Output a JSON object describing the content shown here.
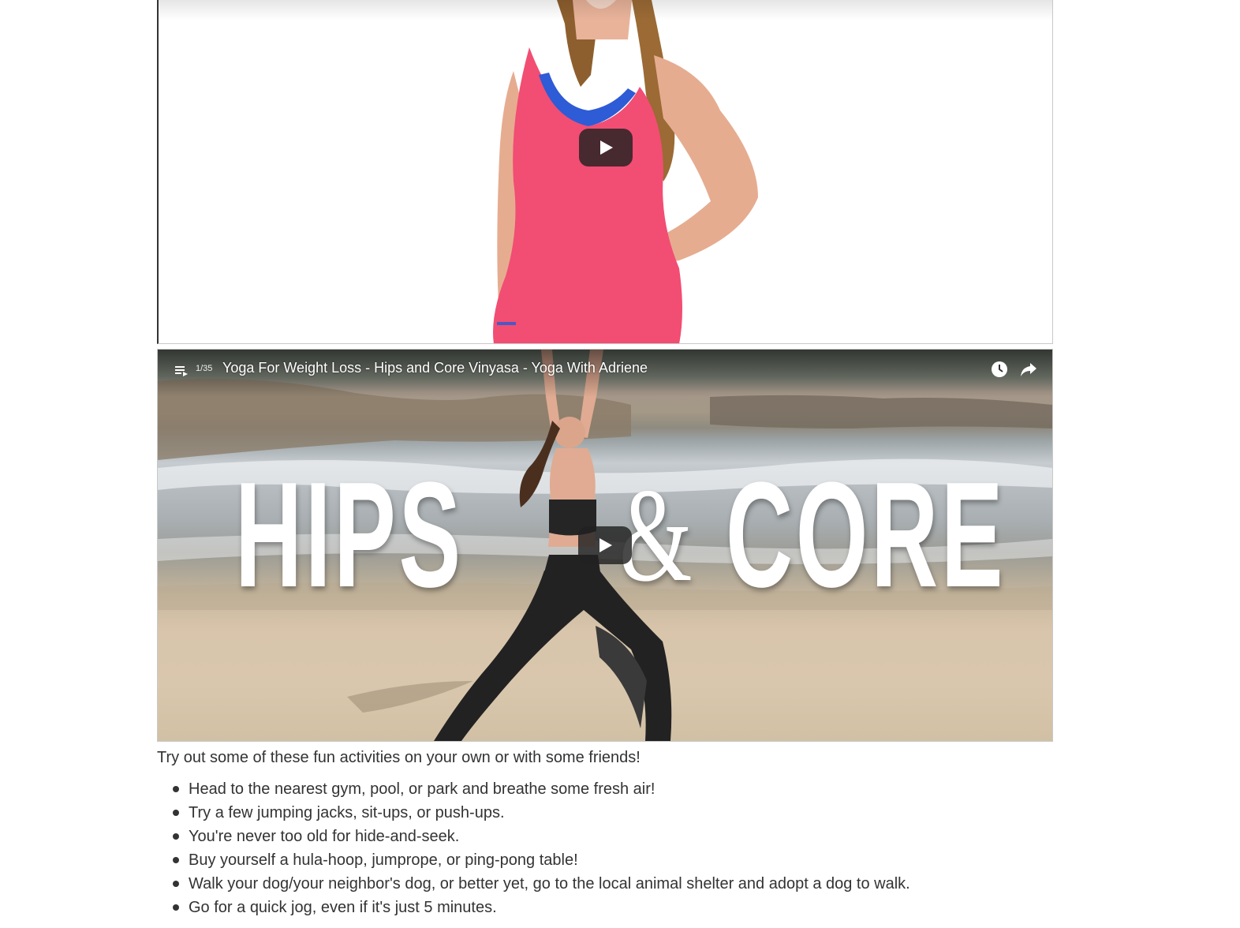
{
  "video1": {
    "play_label": "Play"
  },
  "video2": {
    "playlist_position": "1/35",
    "title": "Yoga For Weight Loss - Hips and Core Vinyasa - Yoga With Adriene",
    "thumbnail_text": {
      "left": "HIPS",
      "amp": "&",
      "right": "CORE"
    },
    "icons": {
      "playlist": "playlist-icon",
      "watch_later": "clock-icon",
      "share": "share-arrow-icon",
      "play": "play-icon"
    }
  },
  "content": {
    "intro": "Try out some of these fun activities on your own or with some friends!",
    "activities": [
      "Head to the nearest gym, pool, or park and breathe some fresh air!",
      "Try a few jumping jacks, sit-ups, or push-ups.",
      "You're never too old for hide-and-seek.",
      "Buy yourself a hula-hoop, jumprope, or ping-pong table!",
      "Walk your dog/your neighbor's dog, or better yet, go to the local animal shelter and adopt a dog to walk.",
      "Go for a quick jog, even if it's just 5 minutes."
    ]
  },
  "colors": {
    "text": "#333333",
    "play_button_bg": "#212121",
    "tank_top": "#f24d73",
    "sports_bra": "#2e5bd6",
    "hair": "#9b6a35",
    "skin": "#e9b39a",
    "yoga_outfit": "#222222"
  }
}
